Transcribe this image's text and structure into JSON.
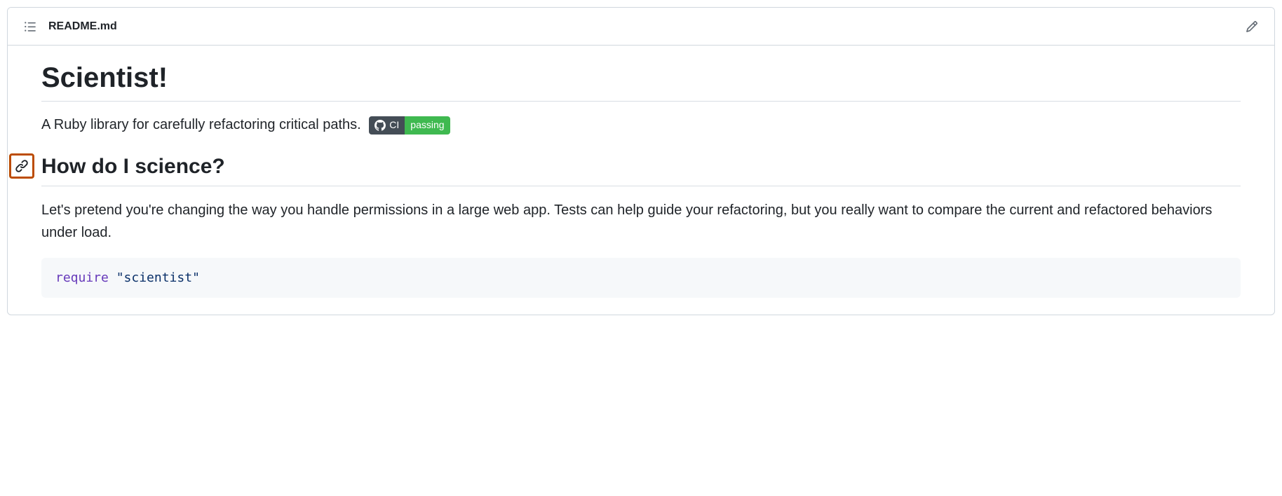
{
  "header": {
    "filename": "README.md"
  },
  "content": {
    "title": "Scientist!",
    "description": "A Ruby library for carefully refactoring critical paths.",
    "badge": {
      "label": "CI",
      "status": "passing"
    },
    "section_heading": "How do I science?",
    "section_body": "Let's pretend you're changing the way you handle permissions in a large web app. Tests can help guide your refactoring, but you really want to compare the current and refactored behaviors under load.",
    "code": {
      "keyword": "require",
      "string": "\"scientist\""
    }
  }
}
